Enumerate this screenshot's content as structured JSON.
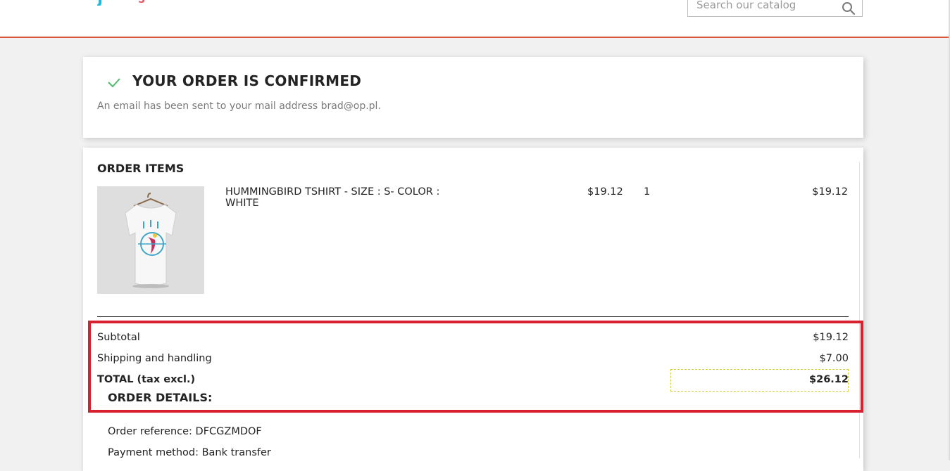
{
  "header": {
    "logo_text": "J",
    "logo_text2": "S",
    "search": {
      "placeholder": "Search our catalog"
    }
  },
  "confirmation": {
    "title": "YOUR ORDER IS CONFIRMED",
    "message": "An email has been sent to your mail address brad@op.pl."
  },
  "order_items": {
    "title": "ORDER ITEMS",
    "items": [
      {
        "name": "HUMMINGBIRD TSHIRT - SIZE : S- COLOR : WHITE",
        "unit_price": "$19.12",
        "quantity": "1",
        "total": "$19.12"
      }
    ]
  },
  "summary": {
    "subtotal_label": "Subtotal",
    "subtotal_value": "$19.12",
    "shipping_label": "Shipping and handling",
    "shipping_value": "$7.00",
    "total_label": "TOTAL (tax excl.)",
    "total_value": "$26.12"
  },
  "order_details": {
    "title": "ORDER DETAILS:",
    "reference": "Order reference: DFCGZMDOF",
    "payment": "Payment method: Bank transfer"
  },
  "colors": {
    "accent": "#d9573b",
    "check": "#4cbb6c",
    "highlight": "#d8202f"
  }
}
